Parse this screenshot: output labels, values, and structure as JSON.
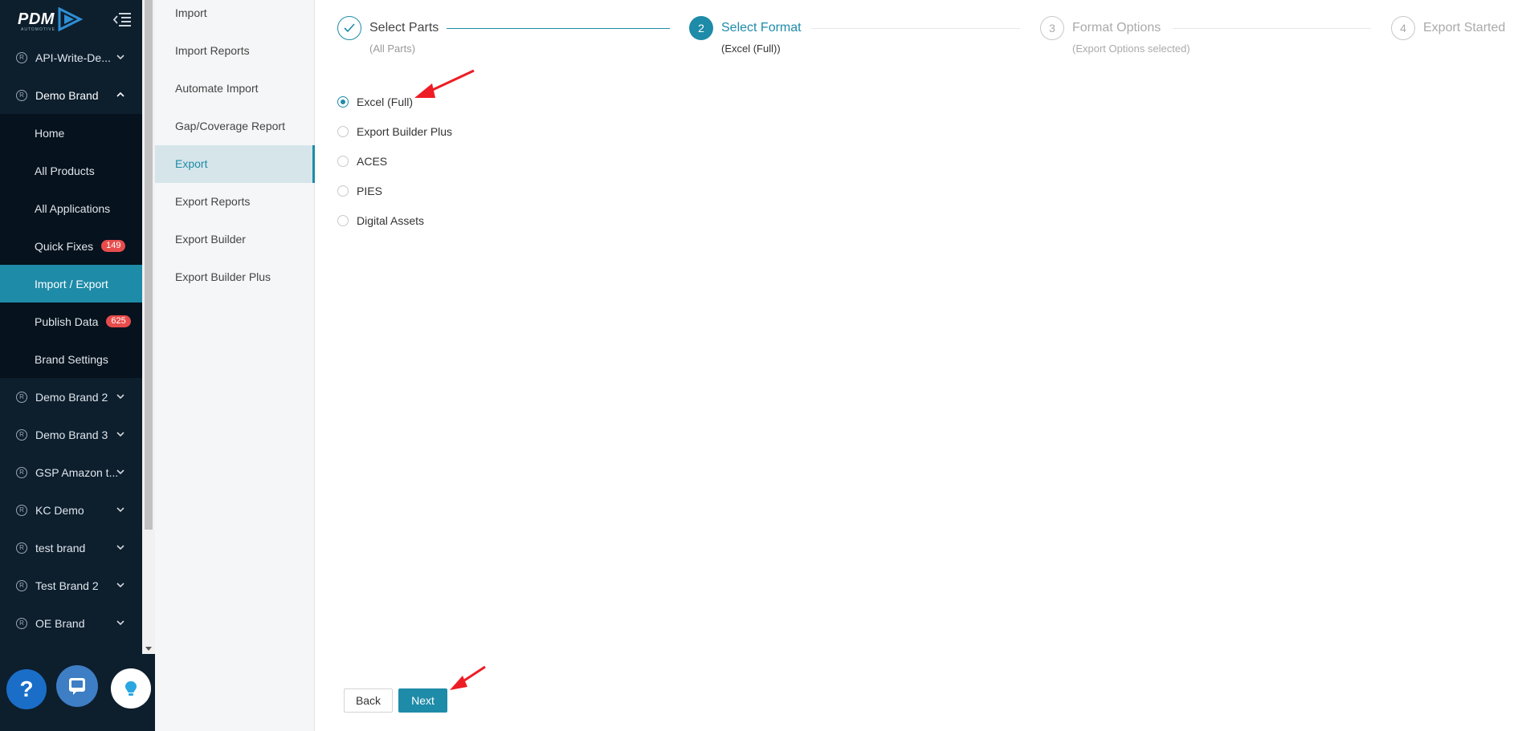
{
  "logo": {
    "text": "PDM",
    "sub": "AUTOMOTIVE"
  },
  "sidebar": {
    "brands_top": [
      {
        "label": "API-Write-De...",
        "mark": "R"
      },
      {
        "label": "Demo Brand",
        "mark": "R"
      }
    ],
    "demo_brand_items": [
      {
        "label": "Home"
      },
      {
        "label": "All Products"
      },
      {
        "label": "All Applications"
      },
      {
        "label": "Quick Fixes",
        "badge": "149"
      },
      {
        "label": "Import / Export"
      },
      {
        "label": "Publish Data",
        "badge": "625"
      },
      {
        "label": "Brand Settings"
      }
    ],
    "brands_bottom": [
      {
        "label": "Demo Brand 2",
        "mark": "R"
      },
      {
        "label": "Demo Brand 3",
        "mark": "R"
      },
      {
        "label": "GSP Amazon t...",
        "mark": "R"
      },
      {
        "label": "KC Demo",
        "mark": "R"
      },
      {
        "label": "test brand",
        "mark": "R"
      },
      {
        "label": "Test Brand 2",
        "mark": "R"
      },
      {
        "label": "OE Brand",
        "mark": "R"
      }
    ],
    "help_label": "?"
  },
  "submenu": [
    "Import",
    "Import Reports",
    "Automate Import",
    "Gap/Coverage Report",
    "Export",
    "Export Reports",
    "Export Builder",
    "Export Builder Plus"
  ],
  "steps": [
    {
      "num": "",
      "title": "Select Parts",
      "sub": "(All Parts)"
    },
    {
      "num": "2",
      "title": "Select Format",
      "sub": "(Excel (Full))"
    },
    {
      "num": "3",
      "title": "Format Options",
      "sub": "(Export Options selected)"
    },
    {
      "num": "4",
      "title": "Export Started",
      "sub": ""
    }
  ],
  "formats": [
    {
      "label": "Excel (Full)",
      "selected": true
    },
    {
      "label": "Export Builder Plus",
      "selected": false
    },
    {
      "label": "ACES",
      "selected": false
    },
    {
      "label": "PIES",
      "selected": false
    },
    {
      "label": "Digital Assets",
      "selected": false
    }
  ],
  "buttons": {
    "back": "Back",
    "next": "Next"
  },
  "colors": {
    "accent": "#1e8ba8",
    "sidebar": "#0d1e2d",
    "badge": "#e74c4c",
    "annotation": "#ee1c24"
  }
}
